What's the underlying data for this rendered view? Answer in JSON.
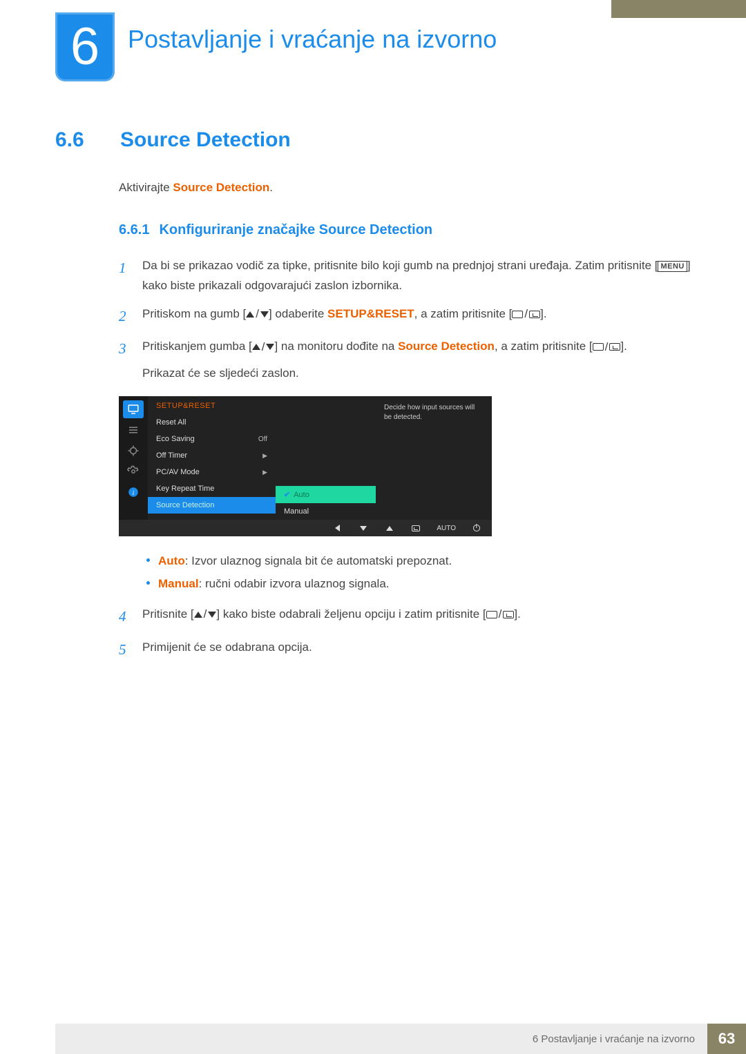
{
  "chapter": {
    "number": "6",
    "title": "Postavljanje i vraćanje na izvorno"
  },
  "section": {
    "number": "6.6",
    "title": "Source Detection"
  },
  "intro": {
    "prefix": "Aktivirajte ",
    "term": "Source Detection",
    "suffix": "."
  },
  "subsection": {
    "number": "6.6.1",
    "title": "Konfiguriranje značajke Source Detection"
  },
  "steps": {
    "s1": {
      "num": "1",
      "t1": "Da bi se prikazao vodič za tipke, pritisnite bilo koji gumb na prednjoj strani uređaja. Zatim pritisnite [",
      "menu": "MENU",
      "t2": "] kako biste prikazali odgovarajući zaslon izbornika."
    },
    "s2": {
      "num": "2",
      "t1": "Pritiskom na gumb [",
      "t2": "] odaberite ",
      "term": "SETUP&RESET",
      "t3": ", a zatim pritisnite [",
      "t4": "]."
    },
    "s3": {
      "num": "3",
      "t1": "Pritiskanjem gumba [",
      "t2": "] na monitoru dođite na ",
      "term": "Source Detection",
      "t3": ", a zatim pritisnite [",
      "t4": "].",
      "line2": "Prikazat će se sljedeći zaslon."
    },
    "s4": {
      "num": "4",
      "t1": "Pritisnite [",
      "t2": "] kako biste odabrali željenu opciju i zatim pritisnite [",
      "t3": "]."
    },
    "s5": {
      "num": "5",
      "t1": "Primijenit će se odabrana opcija."
    }
  },
  "osd": {
    "menu_title": "SETUP&RESET",
    "items": {
      "reset": "Reset All",
      "eco": "Eco Saving",
      "eco_val": "Off",
      "offtimer": "Off Timer",
      "pcav": "PC/AV Mode",
      "keyrepeat": "Key Repeat Time",
      "sourcedet": "Source Detection"
    },
    "options": {
      "auto": "Auto",
      "manual": "Manual"
    },
    "info": "Decide how input sources will be detected.",
    "footer_auto": "AUTO"
  },
  "bullets": {
    "auto_term": "Auto",
    "auto_text": ": Izvor ulaznog signala bit će automatski prepoznat.",
    "manual_term": "Manual",
    "manual_text": ": ručni odabir izvora ulaznog signala."
  },
  "footer": {
    "text": "6 Postavljanje i vraćanje na izvorno",
    "page": "63"
  }
}
